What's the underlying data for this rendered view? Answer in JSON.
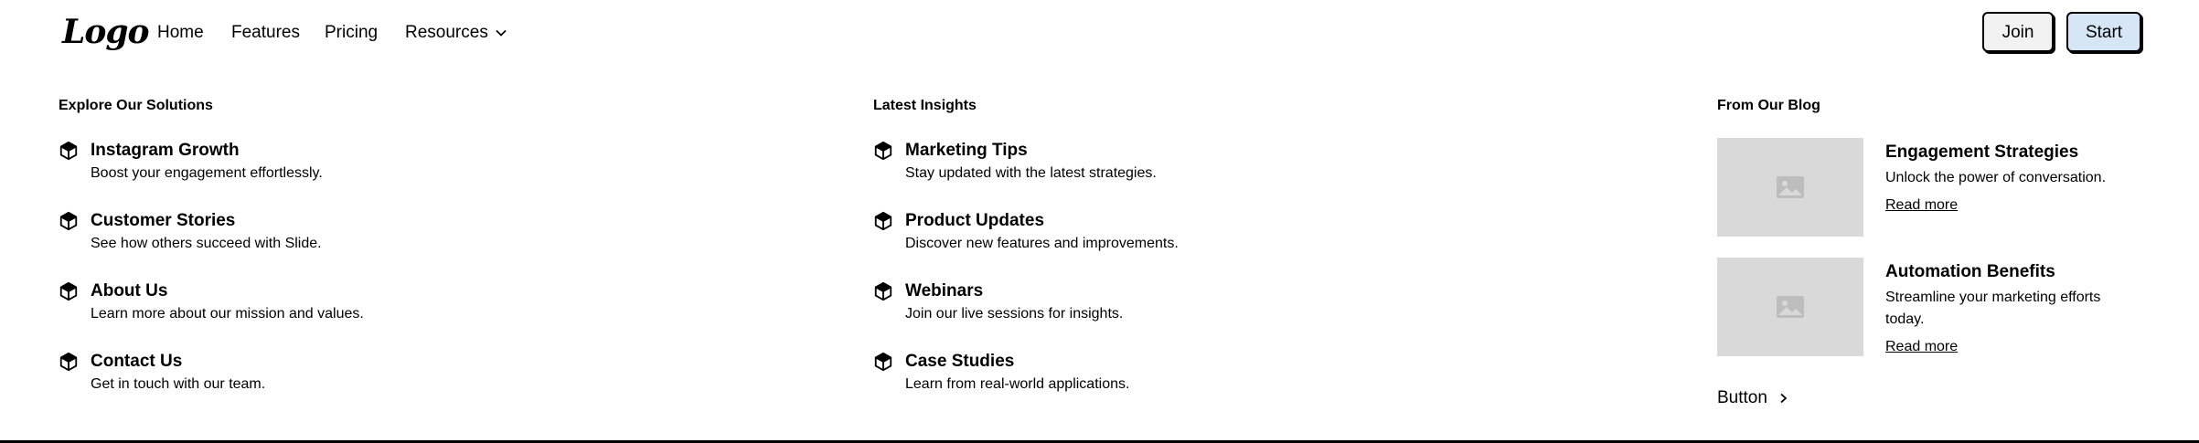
{
  "nav": {
    "logo": "Logo",
    "links": [
      "Home",
      "Features",
      "Pricing",
      "Resources"
    ],
    "join": "Join",
    "start": "Start"
  },
  "col1": {
    "title": "Explore Our Solutions",
    "items": [
      {
        "title": "Instagram Growth",
        "desc": "Boost your engagement effortlessly."
      },
      {
        "title": "Customer Stories",
        "desc": "See how others succeed with Slide."
      },
      {
        "title": "About Us",
        "desc": "Learn more about our mission and values."
      },
      {
        "title": "Contact Us",
        "desc": "Get in touch with our team."
      }
    ]
  },
  "col2": {
    "title": "Latest Insights",
    "items": [
      {
        "title": "Marketing Tips",
        "desc": "Stay updated with the latest strategies."
      },
      {
        "title": "Product Updates",
        "desc": "Discover new features and improvements."
      },
      {
        "title": "Webinars",
        "desc": "Join our live sessions for insights."
      },
      {
        "title": "Case Studies",
        "desc": "Learn from real-world applications."
      }
    ]
  },
  "col3": {
    "title": "From Our Blog",
    "posts": [
      {
        "title": "Engagement Strategies",
        "desc": "Unlock the power of conversation.",
        "link": "Read more"
      },
      {
        "title": "Automation Benefits",
        "desc": "Streamline your marketing efforts today.",
        "link": "Read more"
      }
    ],
    "button": "Button"
  }
}
